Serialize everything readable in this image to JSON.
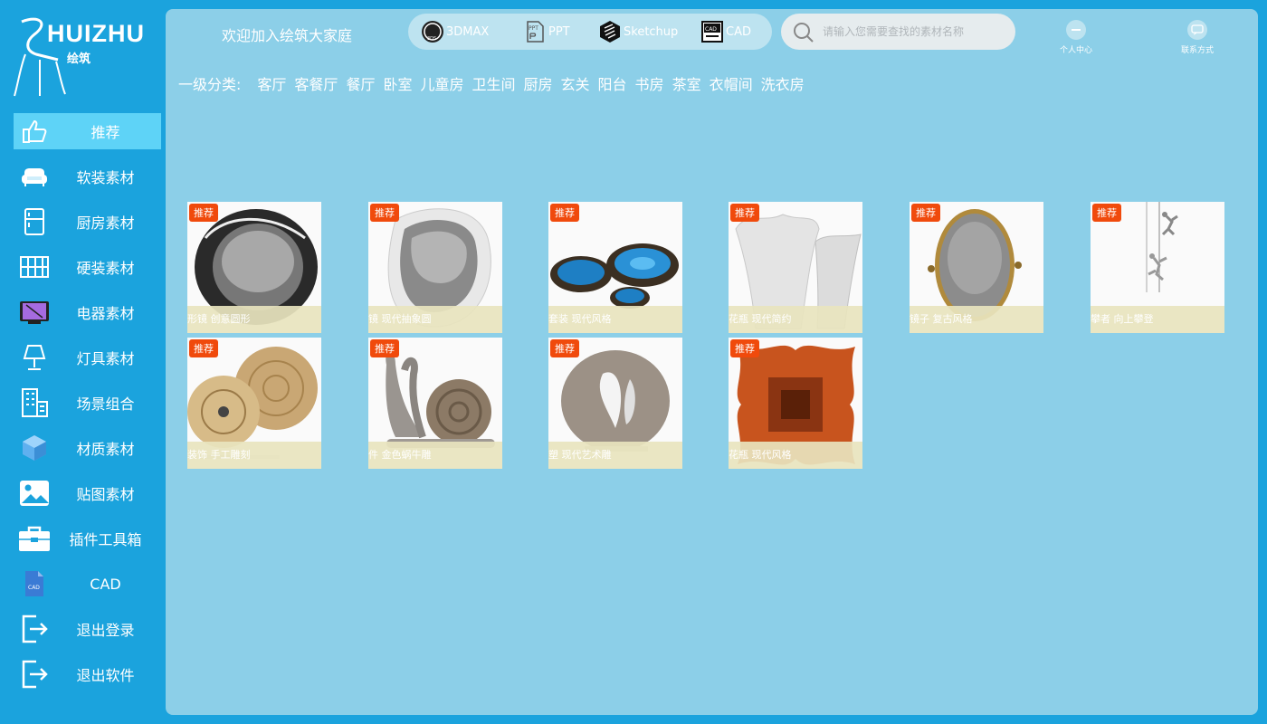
{
  "brand": {
    "name": "HUIZHU",
    "name_cn": "绘筑"
  },
  "sidebar": {
    "items": [
      {
        "label": "推荐",
        "icon": "thumbs-up-icon",
        "active": true
      },
      {
        "label": "软装素材",
        "icon": "sofa-icon",
        "active": false
      },
      {
        "label": "厨房素材",
        "icon": "fridge-icon",
        "active": false
      },
      {
        "label": "硬装素材",
        "icon": "wall-panel-icon",
        "active": false
      },
      {
        "label": "电器素材",
        "icon": "tv-icon",
        "active": false
      },
      {
        "label": "灯具素材",
        "icon": "lamp-icon",
        "active": false
      },
      {
        "label": "场景组合",
        "icon": "building-icon",
        "active": false
      },
      {
        "label": "材质素材",
        "icon": "cube-icon",
        "active": false
      },
      {
        "label": "贴图素材",
        "icon": "image-icon",
        "active": false
      },
      {
        "label": "插件工具箱",
        "icon": "toolbox-icon",
        "active": false
      },
      {
        "label": "CAD",
        "icon": "cad-file-icon",
        "active": false
      },
      {
        "label": "退出登录",
        "icon": "logout-icon",
        "active": false
      },
      {
        "label": "退出软件",
        "icon": "exit-icon",
        "active": false
      }
    ]
  },
  "header": {
    "welcome": "欢迎加入绘筑大家庭",
    "formats": [
      {
        "label": "3DMAX",
        "icon": "3ds-icon"
      },
      {
        "label": "PPT",
        "icon": "ppt-icon"
      },
      {
        "label": "Sketchup",
        "icon": "sketchup-icon"
      },
      {
        "label": "CAD",
        "icon": "cad-icon"
      }
    ],
    "search_placeholder": "请输入您需要查找的素材名称",
    "personal_center": "个人中心",
    "contact": "联系方式"
  },
  "categories": {
    "title": "一级分类:",
    "items": [
      "客厅",
      "客餐厅",
      "餐厅",
      "卧室",
      "儿童房",
      "卫生间",
      "厨房",
      "玄关",
      "阳台",
      "书房",
      "茶室",
      "衣帽间",
      "洗衣房"
    ]
  },
  "cards": [
    {
      "badge": "推荐",
      "caption": "形镜 创意圆形",
      "image": "black-round-mirror"
    },
    {
      "badge": "推荐",
      "caption": "镜 现代抽象圆",
      "image": "abstract-mirror"
    },
    {
      "badge": "推荐",
      "caption": "套装 现代风格",
      "image": "blue-bowls"
    },
    {
      "badge": "推荐",
      "caption": "花瓶 现代简约",
      "image": "white-vases"
    },
    {
      "badge": "推荐",
      "caption": "镜子 复古风格",
      "image": "oval-mirror"
    },
    {
      "badge": "推荐",
      "caption": "攀者 向上攀登",
      "image": "climbing-figures"
    },
    {
      "badge": "推荐",
      "caption": "装饰 手工雕刻",
      "image": "wood-discs"
    },
    {
      "badge": "推荐",
      "caption": "件 金色蜗牛雕",
      "image": "snail-sculpture"
    },
    {
      "badge": "推荐",
      "caption": "塑 现代艺术雕",
      "image": "twisted-sculpture"
    },
    {
      "badge": "推荐",
      "caption": "花瓶 现代风格",
      "image": "copper-vase"
    }
  ],
  "colors": {
    "sidebar_bg": "#1ba3dd",
    "main_bg": "#8ccfe8",
    "active_item": "#5ed3f7",
    "badge": "#f04a0c"
  }
}
